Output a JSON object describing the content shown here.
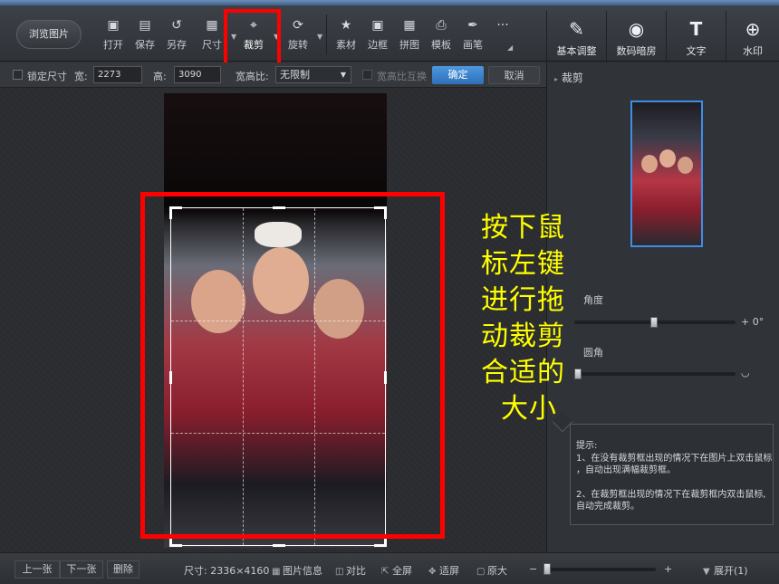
{
  "toolbar": {
    "browse_label": "浏览图片",
    "tools": [
      {
        "label": "打开",
        "icon": "open-icon"
      },
      {
        "label": "保存",
        "icon": "save-icon"
      },
      {
        "label": "另存",
        "icon": "save-as-icon"
      },
      {
        "label": "尺寸",
        "icon": "resize-icon"
      },
      {
        "label": "裁剪",
        "icon": "crop-icon"
      },
      {
        "label": "旋转",
        "icon": "rotate-icon"
      },
      {
        "label": "素材",
        "icon": "material-icon"
      },
      {
        "label": "边框",
        "icon": "border-icon"
      },
      {
        "label": "拼图",
        "icon": "collage-icon"
      },
      {
        "label": "模板",
        "icon": "template-icon"
      },
      {
        "label": "画笔",
        "icon": "brush-icon"
      }
    ],
    "more_label": "···",
    "right_tools": [
      {
        "label": "基本调整",
        "icon": "adjust-icon"
      },
      {
        "label": "数码暗房",
        "icon": "darkroom-icon"
      },
      {
        "label": "文字",
        "icon": "text-icon"
      },
      {
        "label": "水印",
        "icon": "watermark-icon"
      }
    ]
  },
  "crop_options": {
    "lock_size_label": "锁定尺寸",
    "width_label": "宽:",
    "width_value": "2273",
    "height_label": "高:",
    "height_value": "3090",
    "ratio_label": "宽高比:",
    "ratio_value": "无限制",
    "swap_label": "宽高比互换",
    "confirm_label": "确定",
    "cancel_label": "取消"
  },
  "annotation": {
    "lines": [
      "按下鼠",
      "标左键",
      "进行拖",
      "动裁剪",
      "合适的",
      "大小"
    ]
  },
  "side_panel": {
    "title": "裁剪",
    "angle_label": "角度",
    "angle_value": "+ 0°",
    "rounded_label": "圆角",
    "tip_title": "提示:",
    "tip_lines": [
      "1、在没有裁剪框出现的情况下在图片上双击鼠标",
      "，自动出现满幅裁剪框。",
      "2、在裁剪框出现的情况下在裁剪框内双击鼠标,",
      "自动完成裁剪。"
    ]
  },
  "statusbar": {
    "prev_label": "上一张",
    "next_label": "下一张",
    "delete_label": "删除",
    "size_text": "尺寸: 2336×4160",
    "info_label": "图片信息",
    "compare_label": "对比",
    "fullscreen_label": "全屏",
    "fit_label": "适屏",
    "original_label": "原大",
    "expand_label": "展开(1)"
  },
  "colors": {
    "highlight_red": "#ff0000",
    "annotation_yellow": "#ffff00",
    "accent_blue": "#3e8ee8"
  }
}
